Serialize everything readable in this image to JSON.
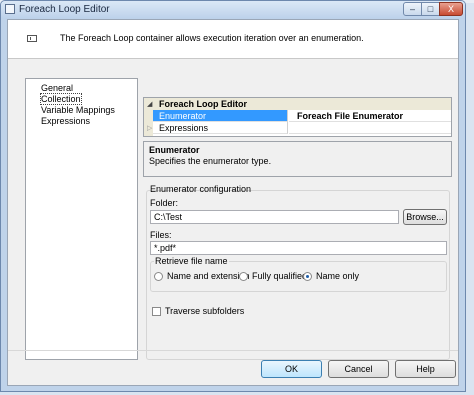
{
  "window": {
    "title": "Foreach Loop Editor",
    "controls": {
      "minimize": "–",
      "maximize": "□",
      "close": "X"
    }
  },
  "header": {
    "description": "The Foreach Loop container allows execution iteration over an enumeration."
  },
  "nav": {
    "items": [
      {
        "label": "General",
        "selected": false
      },
      {
        "label": "Collection",
        "selected": true
      },
      {
        "label": "Variable Mappings",
        "selected": false
      },
      {
        "label": "Expressions",
        "selected": false
      }
    ]
  },
  "property_grid": {
    "category": "Foreach Loop Editor",
    "rows": [
      {
        "name": "Enumerator",
        "value": "Foreach File Enumerator",
        "selected": true
      },
      {
        "name": "Expressions",
        "value": "",
        "selected": false
      }
    ]
  },
  "description_panel": {
    "title": "Enumerator",
    "text": "Specifies the enumerator type."
  },
  "enumerator_config": {
    "title": "Enumerator configuration",
    "folder_label": "Folder:",
    "folder_value": "C:\\Test",
    "browse_label": "Browse...",
    "files_label": "Files:",
    "files_value": "*.pdf*",
    "retrieve_title": "Retrieve file name",
    "options": [
      {
        "label": "Name and extension",
        "checked": false
      },
      {
        "label": "Fully qualified",
        "checked": false
      },
      {
        "label": "Name only",
        "checked": true
      }
    ],
    "traverse_label": "Traverse subfolders",
    "traverse_checked": false
  },
  "footer": {
    "ok_label": "OK",
    "cancel_label": "Cancel",
    "help_label": "Help"
  },
  "colors": {
    "selection": "#3399ff",
    "window_frame": "#bfd3ea",
    "dialog_bg": "#f0f0f0"
  }
}
